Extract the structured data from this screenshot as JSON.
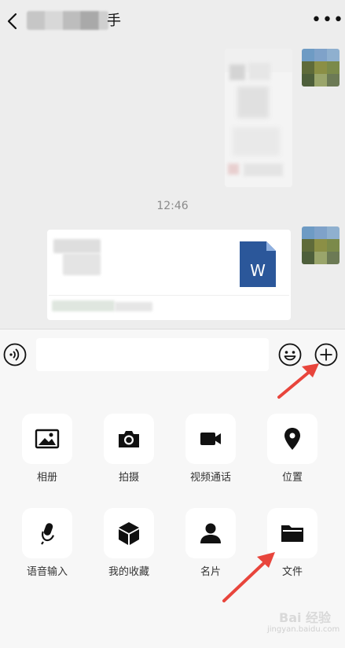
{
  "header": {
    "title_suffix": "手",
    "back_icon": "chevron-left-icon",
    "more_icon": "more-dots-icon"
  },
  "chat": {
    "timestamp": "12:46",
    "file_icon_letter": "W"
  },
  "input": {
    "voice_icon": "voice-icon",
    "emoji_icon": "emoji-icon",
    "plus_icon": "plus-icon"
  },
  "panel": {
    "items": [
      {
        "label": "相册",
        "icon": "image-icon"
      },
      {
        "label": "拍摄",
        "icon": "camera-icon"
      },
      {
        "label": "视频通话",
        "icon": "video-call-icon"
      },
      {
        "label": "位置",
        "icon": "location-icon"
      },
      {
        "label": "语音输入",
        "icon": "microphone-icon"
      },
      {
        "label": "我的收藏",
        "icon": "favorites-cube-icon"
      },
      {
        "label": "名片",
        "icon": "contact-card-icon"
      },
      {
        "label": "文件",
        "icon": "folder-icon"
      }
    ]
  },
  "colors": {
    "background": "#ededed",
    "panel": "#f7f7f7",
    "word_blue": "#2b579a",
    "arrow_red": "#e8453c"
  },
  "watermark": {
    "text": "Bai 经验",
    "sub": "jingyan.baidu.com"
  }
}
